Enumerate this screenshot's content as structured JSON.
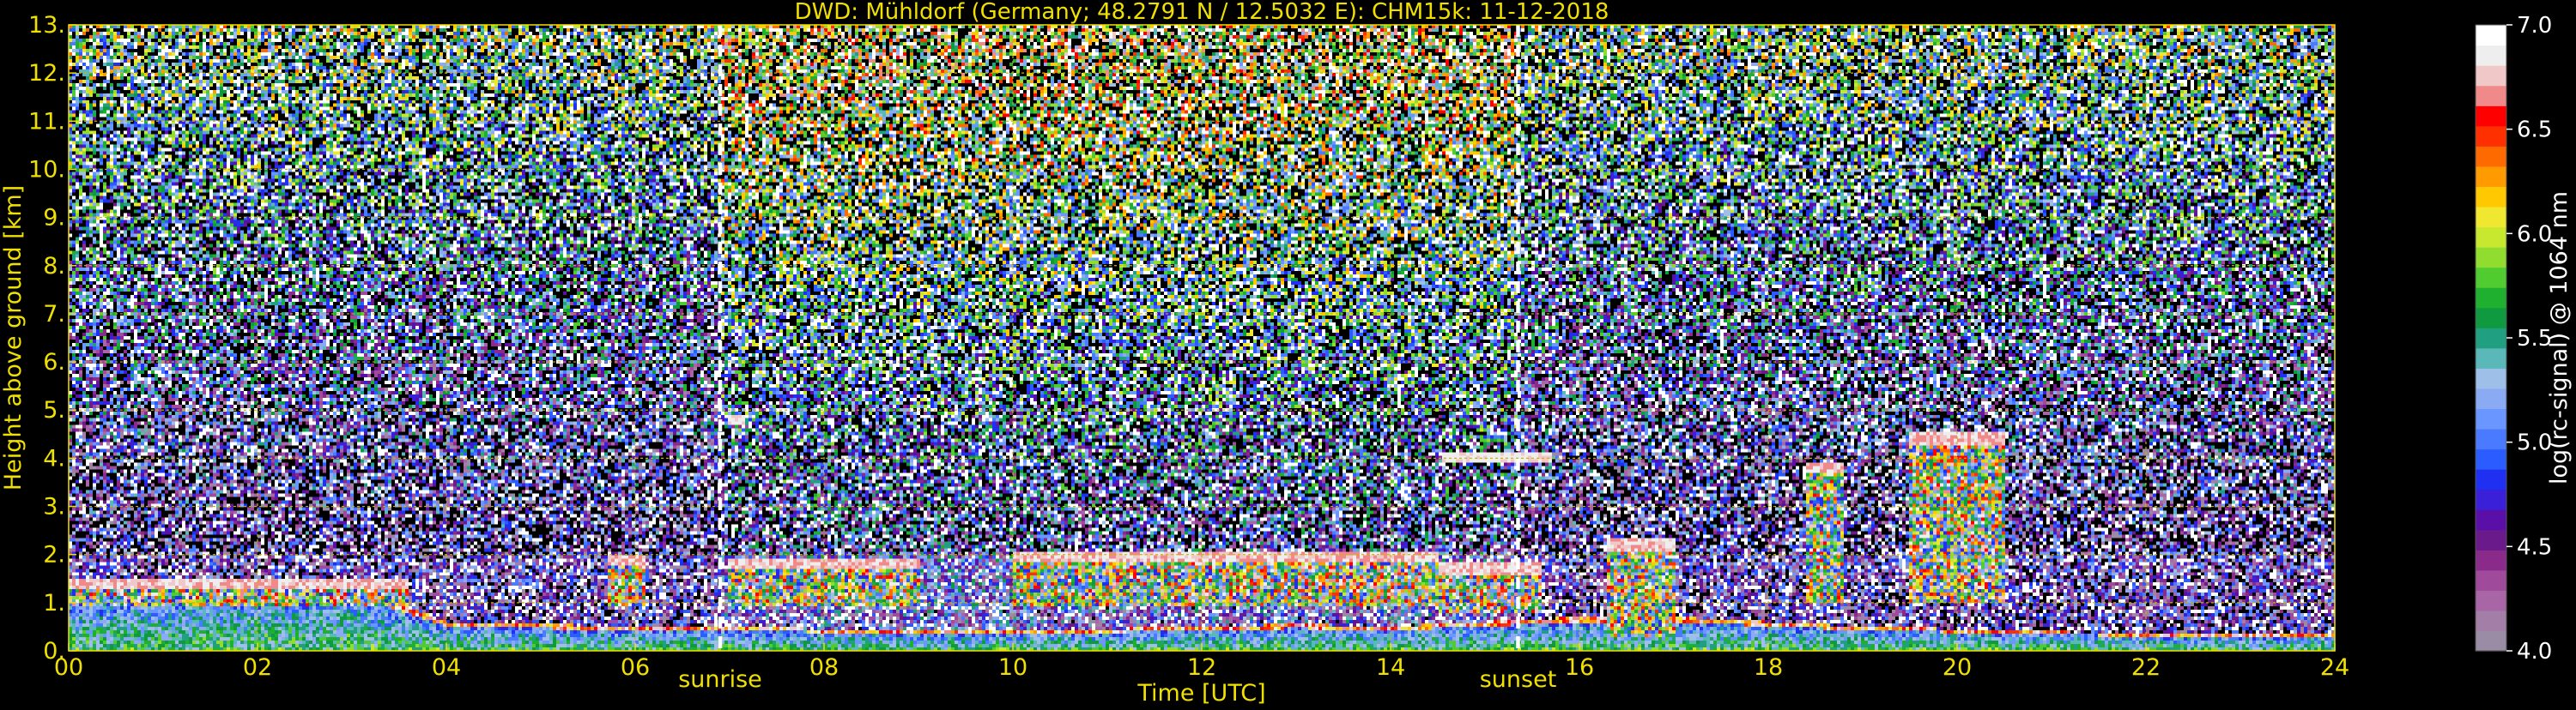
{
  "chart_data": {
    "type": "heatmap",
    "title": "DWD: Mühldorf (Germany; 48.2791 N / 12.5032 E):    CHM15k: 11-12-2018",
    "xlabel": "Time [UTC]",
    "ylabel": "Height above ground [km]",
    "xlim": [
      0,
      24
    ],
    "ylim": [
      0,
      13
    ],
    "x_ticks": [
      {
        "v": 0,
        "label": "00"
      },
      {
        "v": 2,
        "label": "02"
      },
      {
        "v": 4,
        "label": "04"
      },
      {
        "v": 6,
        "label": "06"
      },
      {
        "v": 8,
        "label": "08"
      },
      {
        "v": 10,
        "label": "10"
      },
      {
        "v": 12,
        "label": "12"
      },
      {
        "v": 14,
        "label": "14"
      },
      {
        "v": 16,
        "label": "16"
      },
      {
        "v": 18,
        "label": "18"
      },
      {
        "v": 20,
        "label": "20"
      },
      {
        "v": 22,
        "label": "22"
      },
      {
        "v": 24,
        "label": "24"
      }
    ],
    "y_ticks": [
      {
        "v": 0,
        "label": "0."
      },
      {
        "v": 1,
        "label": "1."
      },
      {
        "v": 2,
        "label": "2."
      },
      {
        "v": 3,
        "label": "3."
      },
      {
        "v": 4,
        "label": "4."
      },
      {
        "v": 5,
        "label": "5."
      },
      {
        "v": 6,
        "label": "6."
      },
      {
        "v": 7,
        "label": "7."
      },
      {
        "v": 8,
        "label": "8."
      },
      {
        "v": 9,
        "label": "9."
      },
      {
        "v": 10,
        "label": "10."
      },
      {
        "v": 11,
        "label": "11."
      },
      {
        "v": 12,
        "label": "12."
      },
      {
        "v": 13,
        "label": "13."
      }
    ],
    "grid": true,
    "events": [
      {
        "time": 6.9,
        "label": "sunrise"
      },
      {
        "time": 15.35,
        "label": "sunset"
      }
    ],
    "features": {
      "boundary_layer_top_km": [
        [
          0,
          1.2
        ],
        [
          1,
          1.3
        ],
        [
          2,
          1.35
        ],
        [
          3,
          1.4
        ],
        [
          3.6,
          0.9
        ],
        [
          4,
          0.6
        ],
        [
          5,
          0.55
        ],
        [
          6,
          0.5
        ],
        [
          7,
          0.5
        ],
        [
          8,
          0.45
        ],
        [
          9,
          0.4
        ],
        [
          10,
          0.4
        ],
        [
          11,
          0.45
        ],
        [
          12,
          0.5
        ],
        [
          13,
          0.55
        ],
        [
          14,
          0.5
        ],
        [
          15,
          0.6
        ],
        [
          16,
          0.7
        ],
        [
          17,
          0.7
        ],
        [
          18,
          0.6
        ],
        [
          19,
          0.5
        ],
        [
          20,
          0.45
        ],
        [
          21,
          0.4
        ],
        [
          22,
          0.35
        ],
        [
          23,
          0.35
        ],
        [
          24,
          0.35
        ]
      ],
      "cloud_layers": [
        {
          "t0": 0.0,
          "t1": 3.6,
          "base_km": 0.9,
          "top_km": 1.4
        },
        {
          "t0": 5.7,
          "t1": 6.1,
          "base_km": 0.9,
          "top_km": 1.9
        },
        {
          "t0": 7.0,
          "t1": 9.0,
          "base_km": 0.9,
          "top_km": 1.8
        },
        {
          "t0": 10.0,
          "t1": 14.5,
          "base_km": 0.9,
          "top_km": 1.95
        },
        {
          "t0": 14.5,
          "t1": 15.6,
          "base_km": 0.8,
          "top_km": 1.7
        },
        {
          "t0": 16.3,
          "t1": 17.0,
          "base_km": 0.3,
          "top_km": 2.2
        },
        {
          "t0": 18.4,
          "t1": 18.8,
          "base_km": 1.0,
          "top_km": 3.8
        },
        {
          "t0": 19.5,
          "t1": 20.5,
          "base_km": 1.0,
          "top_km": 4.4
        }
      ],
      "elevated_layers": [
        {
          "t0": 14.55,
          "t1": 15.7,
          "height_km": 4.0
        },
        {
          "t0": 7.0,
          "t1": 7.15,
          "height_km": 4.8
        }
      ]
    },
    "colorbar": {
      "label": "log(rc-signal) @ 1064 nm",
      "range": [
        4.0,
        7.0
      ],
      "tick_values": [
        4.0,
        4.5,
        5.0,
        5.5,
        6.0,
        6.5,
        7.0
      ],
      "tick_labels": [
        "4.0",
        "4.5",
        "5.0",
        "5.5",
        "6.0",
        "6.5",
        "7.0"
      ],
      "colors": [
        "#9a8ca4",
        "#a37fa8",
        "#a866a6",
        "#a04a9c",
        "#8a2a8a",
        "#6a1a8a",
        "#5a10a8",
        "#3a20d8",
        "#2030f0",
        "#2a5cff",
        "#4a7aff",
        "#6a96ff",
        "#8aaaf4",
        "#9ec0e8",
        "#5ab8b8",
        "#20a080",
        "#109a40",
        "#20b030",
        "#50cc30",
        "#90dd30",
        "#c8e830",
        "#f0e830",
        "#ffc800",
        "#ff9a00",
        "#ff6a00",
        "#ff3000",
        "#ff0000",
        "#f08a8a",
        "#f0c8c8",
        "#eeeeee",
        "#ffffff"
      ]
    },
    "tick_color": "#f0e000",
    "grid_color": "#c8b400"
  }
}
